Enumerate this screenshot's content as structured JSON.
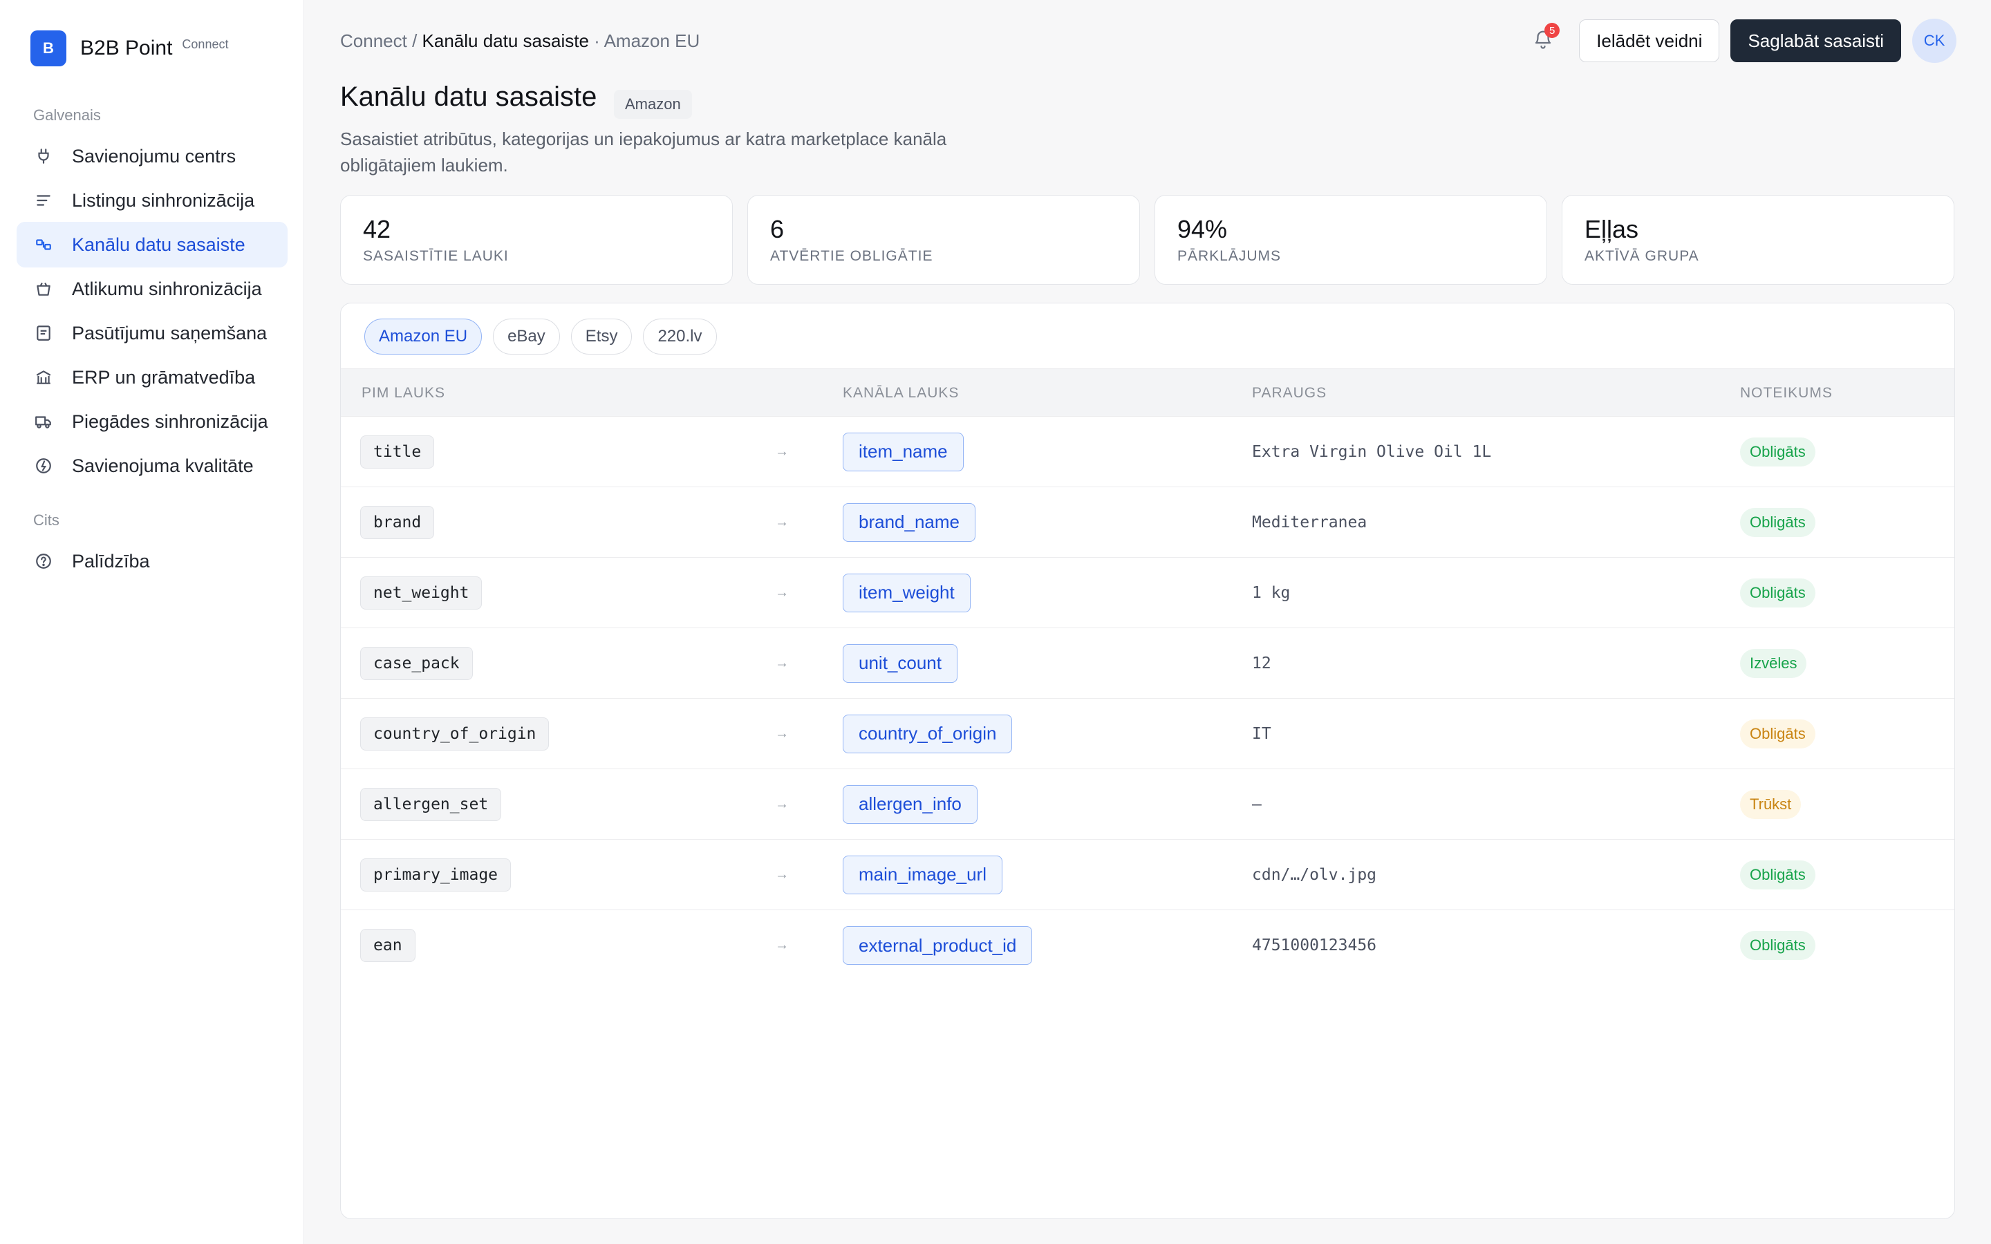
{
  "app": {
    "brand_initial": "B",
    "brand_name": "B2B Point",
    "brand_sub": "Connect",
    "accent_color": "#2563eb"
  },
  "sidebar": {
    "group_main": "Galvenais",
    "group_other": "Cits",
    "items": [
      {
        "label": "Savienojumu centrs",
        "icon": "plug-icon"
      },
      {
        "label": "Listingu sinhronizācija",
        "icon": "list-icon"
      },
      {
        "label": "Kanālu datu sasaiste",
        "icon": "mapping-icon",
        "active": true
      },
      {
        "label": "Atlikumu sinhronizācija",
        "icon": "basket-icon"
      },
      {
        "label": "Pasūtījumu saņemšana",
        "icon": "order-icon"
      },
      {
        "label": "ERP un grāmatvedība",
        "icon": "bank-icon"
      },
      {
        "label": "Piegādes sinhronizācija",
        "icon": "truck-icon"
      },
      {
        "label": "Savienojuma kvalitāte",
        "icon": "gauge-icon"
      }
    ],
    "other_items": [
      {
        "label": "Palīdzība",
        "icon": "help-icon"
      }
    ]
  },
  "topbar": {
    "breadcrumb_root": "Connect",
    "breadcrumb_sep": " / ",
    "breadcrumb_current": "Kanālu datu sasaiste",
    "breadcrumb_suffix": " · Amazon EU",
    "notification_count": "5",
    "load_template_label": "Ielādēt veidni",
    "save_label": "Saglabāt sasaisti",
    "avatar_initials": "CK"
  },
  "header": {
    "title": "Kanālu datu sasaiste",
    "pill": "Amazon",
    "description": "Sasaistiet atribūtus, kategorijas un iepakojumus ar katra marketplace kanāla obligātajiem laukiem."
  },
  "stats": [
    {
      "value": "42",
      "label": "SASAISTĪTIE LAUKI"
    },
    {
      "value": "6",
      "label": "ATVĒRTIE OBLIGĀTIE"
    },
    {
      "value": "94%",
      "label": "PĀRKLĀJUMS"
    },
    {
      "value": "Eļļas",
      "label": "AKTĪVĀ GRUPA"
    }
  ],
  "tabs": [
    {
      "label": "Amazon EU",
      "active": true
    },
    {
      "label": "eBay"
    },
    {
      "label": "Etsy"
    },
    {
      "label": "220.lv"
    }
  ],
  "table": {
    "columns": [
      "PIM LAUKS",
      "KANĀLA LAUKS",
      "PARAUGS",
      "NOTEIKUMS"
    ],
    "arrow": "→",
    "rows": [
      {
        "pim": "title",
        "channel": "item_name",
        "sample": "Extra Virgin Olive Oil 1L",
        "rule": "Obligāts",
        "rule_color": "#16a34a"
      },
      {
        "pim": "brand",
        "channel": "brand_name",
        "sample": "Mediterranea",
        "rule": "Obligāts",
        "rule_color": "#16a34a"
      },
      {
        "pim": "net_weight",
        "channel": "item_weight",
        "sample": "1 kg",
        "rule": "Obligāts",
        "rule_color": "#16a34a"
      },
      {
        "pim": "case_pack",
        "channel": "unit_count",
        "sample": "12",
        "rule": "Izvēles",
        "rule_color": "#16a34a"
      },
      {
        "pim": "country_of_origin",
        "channel": "country_of_origin",
        "sample": "IT",
        "rule": "Obligāts",
        "rule_color": "#c98412"
      },
      {
        "pim": "allergen_set",
        "channel": "allergen_info",
        "sample": "—",
        "rule": "Trūkst",
        "rule_color": "#c98412"
      },
      {
        "pim": "primary_image",
        "channel": "main_image_url",
        "sample": "cdn/…/olv.jpg",
        "rule": "Obligāts",
        "rule_color": "#16a34a"
      },
      {
        "pim": "ean",
        "channel": "external_product_id",
        "sample": "4751000123456",
        "rule": "Obligāts",
        "rule_color": "#16a34a"
      }
    ]
  }
}
